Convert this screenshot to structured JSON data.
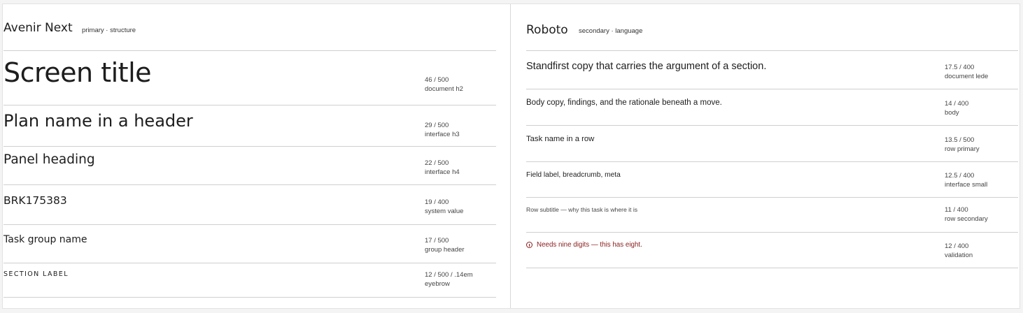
{
  "primary": {
    "name": "Avenir Next",
    "role": "primary · structure",
    "rows": [
      {
        "sample": "Screen title",
        "spec": "46 / 500",
        "usage": "document h2"
      },
      {
        "sample": "Plan name in a header",
        "spec": "29 / 500",
        "usage": "interface h3"
      },
      {
        "sample": "Panel heading",
        "spec": "22 / 500",
        "usage": "interface h4"
      },
      {
        "sample": "BRK175383",
        "spec": "19 / 400",
        "usage": "system value"
      },
      {
        "sample": "Task group name",
        "spec": "17 / 500",
        "usage": "group header"
      },
      {
        "sample": "SECTION LABEL",
        "spec": "12 / 500 / .14em",
        "usage": "eyebrow"
      }
    ]
  },
  "secondary": {
    "name": "Roboto",
    "role": "secondary · language",
    "rows": [
      {
        "sample": "Standfirst copy that carries the argument of a section.",
        "spec": "17.5 / 400",
        "usage": "document lede"
      },
      {
        "sample": "Body copy, findings, and the rationale beneath a move.",
        "spec": "14 / 400",
        "usage": "body"
      },
      {
        "sample": "Task name in a row",
        "spec": "13.5 / 500",
        "usage": "row primary"
      },
      {
        "sample": "Field label, breadcrumb, meta",
        "spec": "12.5 / 400",
        "usage": "interface small"
      },
      {
        "sample": "Row subtitle — why this task is where it is",
        "spec": "11 / 400",
        "usage": "row secondary"
      },
      {
        "sample": "Needs nine digits — this has eight.",
        "spec": "12 / 400",
        "usage": "validation",
        "icon": "error-circle-icon"
      }
    ]
  },
  "colors": {
    "error": "#8a1c1c",
    "divider": "#cfcfcf",
    "text": "#1d1d1d"
  }
}
